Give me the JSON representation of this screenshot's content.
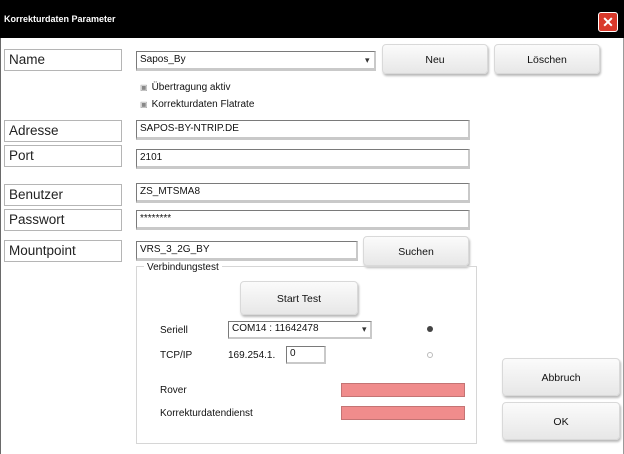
{
  "window": {
    "title": "Korrekturdaten Parameter",
    "close_glyph": "✕"
  },
  "labels": {
    "name": "Name",
    "adresse": "Adresse",
    "port": "Port",
    "benutzer": "Benutzer",
    "passwort": "Passwort",
    "mountpoint": "Mountpoint"
  },
  "fields": {
    "name_value": "Sapos_By",
    "adresse_value": "SAPOS-BY-NTRIP.DE",
    "port_value": "2101",
    "benutzer_value": "ZS_MTSMA8",
    "passwort_value": "********",
    "mountpoint_value": "VRS_3_2G_BY"
  },
  "checkboxes": {
    "uebertragung": {
      "label": "Übertragung aktiv",
      "checked": true
    },
    "flatrate": {
      "label": "Korrekturdaten Flatrate",
      "checked": true
    }
  },
  "buttons": {
    "neu": "Neu",
    "loeschen": "Löschen",
    "suchen": "Suchen",
    "start_test": "Start Test",
    "abbruch": "Abbruch",
    "ok": "OK"
  },
  "verbindungstest": {
    "title": "Verbindungstest",
    "seriell_label": "Seriell",
    "seriell_value": "COM14 : 11642478",
    "tcpip_label": "TCP/IP",
    "tcpip_prefix": "169.254.1.",
    "tcpip_value": "0",
    "seriell_radio_selected": true,
    "tcpip_radio_selected": false,
    "rover_label": "Rover",
    "korrekturdienst_label": "Korrekturdatendienst",
    "status_color": "#f08c8c"
  },
  "colors": {
    "titlebar": "#000000",
    "close_button": "#d9392b"
  }
}
